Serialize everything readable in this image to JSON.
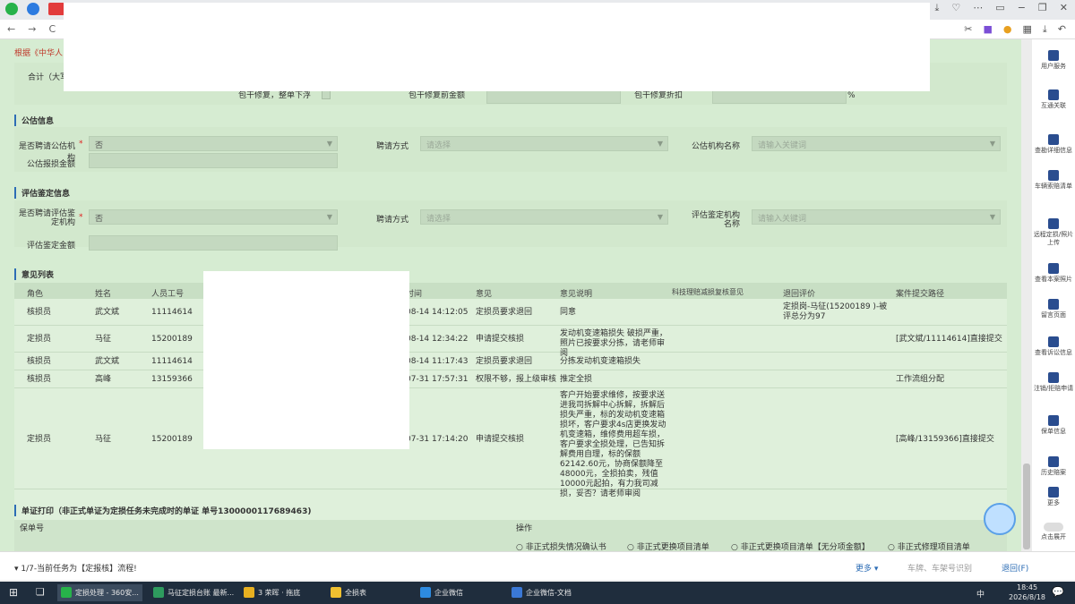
{
  "browser": {
    "tool_icons": [
      "⤓",
      "♡",
      "⋯",
      "▭",
      "−",
      "❐",
      "✕"
    ],
    "nav": [
      "←",
      "→",
      "C"
    ]
  },
  "header_text": "根据《中华人",
  "top": {
    "total_label": "合计（大写",
    "row2_labels": [
      "包干修复，整单下浮",
      "包干修复前金额",
      "包干修复折扣"
    ],
    "percent": "%"
  },
  "public_eval": {
    "title": "公估信息",
    "hire_label": "是否聘请公估机构",
    "hire_value": "否",
    "mode_label": "聘请方式",
    "mode_ph": "请选择",
    "org_label": "公估机构名称",
    "org_ph": "请输入关键词",
    "amount_label": "公估报损金额"
  },
  "assess": {
    "title": "评估鉴定信息",
    "hire_label": "是否聘请评估鉴定机构",
    "hire_value": "否",
    "mode_label": "聘请方式",
    "mode_ph": "请选择",
    "org_label": "评估鉴定机构名称",
    "org_ph": "请输入关键词",
    "amount_label": "评估鉴定金额"
  },
  "opinion": {
    "title": "意见列表",
    "headers": [
      "角色",
      "姓名",
      "人员工号",
      "",
      "时间",
      "意见",
      "意见说明",
      "科技理赔减损复核意见",
      "退回评价",
      "案件提交路径"
    ],
    "rows": [
      {
        "role": "核损员",
        "name": "武文斌",
        "id": "11114614",
        "time": "08-14 14:12:05",
        "opinion": "定损员要求退回",
        "desc": "同意",
        "review": "",
        "eval": "定损岗-马征(15200189 )-被评总分为97",
        "path": ""
      },
      {
        "role": "定损员",
        "name": "马征",
        "id": "15200189",
        "time": "08-14 12:34:22",
        "opinion": "申请提交核损",
        "desc": "发动机变速箱损失 破损严重，照片已按要求分拣，请老师审阅",
        "review": "",
        "eval": "",
        "path": "[武文斌/11114614]直接提交"
      },
      {
        "role": "核损员",
        "name": "武文斌",
        "id": "11114614",
        "time": "08-14 11:17:43",
        "opinion": "定损员要求退回",
        "desc": "分拣发动机变速箱损失",
        "review": "",
        "eval": "",
        "path": ""
      },
      {
        "role": "核损员",
        "name": "高峰",
        "id": "13159366",
        "time": "07-31 17:57:31",
        "opinion": "权限不够，报上级审核",
        "desc": "推定全损",
        "review": "",
        "eval": "",
        "path": "工作流组分配"
      },
      {
        "role": "定损员",
        "name": "马征",
        "id": "15200189",
        "time": "07-31 17:14:20",
        "opinion": "申请提交核损",
        "desc": "客户开始要求维修，按要求送进我司拆解中心拆解，拆解后损失严重，标的发动机变速箱损坏，客户要求4s店更换发动机变速箱，维修费用超车损，客户要求全损处理，已告知拆解费用自理，标的保额62142.60元，协商保额降至48000元，全损拍卖，残值10000元起拍，有力我司减损，妥否？请老师审阅",
        "review": "",
        "eval": "",
        "path": "[高峰/13159366]直接提交"
      }
    ]
  },
  "print": {
    "title": "单证打印（非正式单证为定损任务未完成时的单证 单号1300000117689463)",
    "col1": "保单号",
    "col2": "操作",
    "options": [
      "非正式损失情况确认书",
      "非正式更换项目清单",
      "非正式更换项目清单【无分项金额】",
      "非正式修理项目清单"
    ]
  },
  "footer": {
    "task_text": "1/7-当前任务为【定报核】流程!",
    "more": "更多",
    "search_ph": "车牌、车架号识别",
    "back": "退回(F)"
  },
  "right_sidebar": [
    "用户服务",
    "互通关联",
    "查勘详细信息",
    "车辆索赔清单",
    "远程定损/照片上传",
    "查看本案照片",
    "留言页面",
    "查看诉讼信息",
    "注销/拒赔申请",
    "保单信息",
    "历史赔案",
    "更多",
    "点击展开"
  ],
  "taskbar": {
    "items": [
      "定损处理 - 360安...",
      "马征定损台账 最新...",
      "3 荣晖 · 拖底",
      "全损表",
      "企业微信",
      "企业微信-文档"
    ],
    "tray": "中",
    "time": "18:45",
    "date": "2026/8/18"
  }
}
